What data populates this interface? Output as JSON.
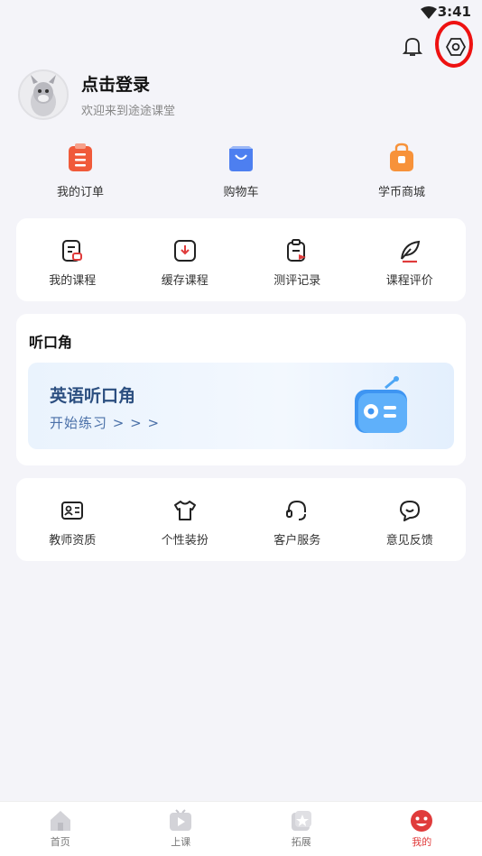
{
  "status": {
    "time": "3:41"
  },
  "profile": {
    "title": "点击登录",
    "subtitle": "欢迎来到途途课堂"
  },
  "quick": [
    {
      "label": "我的订单",
      "icon": "order-icon"
    },
    {
      "label": "购物车",
      "icon": "cart-icon"
    },
    {
      "label": "学币商城",
      "icon": "shop-icon"
    }
  ],
  "courses": [
    {
      "label": "我的课程",
      "icon": "course-icon"
    },
    {
      "label": "缓存课程",
      "icon": "download-icon"
    },
    {
      "label": "测评记录",
      "icon": "clipboard-icon"
    },
    {
      "label": "课程评价",
      "icon": "feather-icon"
    }
  ],
  "listen": {
    "section_title": "听口角",
    "banner_title": "英语听口角",
    "banner_sub": "开始练习 > > >"
  },
  "services": [
    {
      "label": "教师资质",
      "icon": "id-card-icon"
    },
    {
      "label": "个性装扮",
      "icon": "shirt-icon"
    },
    {
      "label": "客户服务",
      "icon": "headset-icon"
    },
    {
      "label": "意见反馈",
      "icon": "smile-icon"
    }
  ],
  "tabs": [
    {
      "label": "首页",
      "icon": "home-icon"
    },
    {
      "label": "上课",
      "icon": "play-icon"
    },
    {
      "label": "拓展",
      "icon": "star-icon"
    },
    {
      "label": "我的",
      "icon": "face-icon"
    }
  ],
  "colors": {
    "accent_red": "#e03b3b",
    "banner_text": "#2c4f80",
    "order_orange": "#f05a3a",
    "cart_blue": "#4d7ff0",
    "shop_orange": "#f7923a"
  }
}
